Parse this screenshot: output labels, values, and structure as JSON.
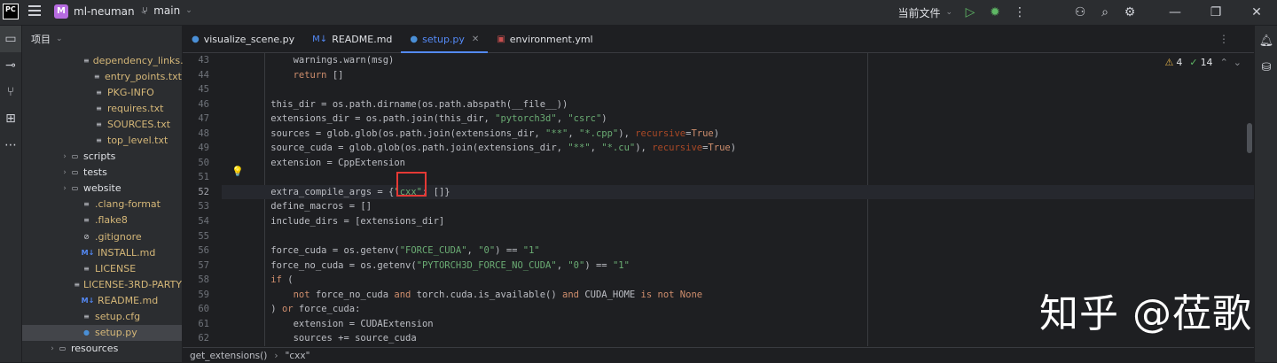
{
  "titlebar": {
    "logo": "PC",
    "project_initial": "M",
    "project_name": "ml-neuman",
    "branch": "main",
    "run_config": "当前文件"
  },
  "project_panel": {
    "title": "项目",
    "items": [
      {
        "label": "dependency_links.txt",
        "kind": "file",
        "color": "#d5b778"
      },
      {
        "label": "entry_points.txt",
        "kind": "file",
        "color": "#d5b778"
      },
      {
        "label": "PKG-INFO",
        "kind": "file",
        "color": "#d5b778"
      },
      {
        "label": "requires.txt",
        "kind": "file",
        "color": "#d5b778"
      },
      {
        "label": "SOURCES.txt",
        "kind": "file",
        "color": "#d5b778"
      },
      {
        "label": "top_level.txt",
        "kind": "file",
        "color": "#d5b778"
      },
      {
        "label": "scripts",
        "kind": "folder",
        "color": "#dfe1e5"
      },
      {
        "label": "tests",
        "kind": "folder",
        "color": "#dfe1e5"
      },
      {
        "label": "website",
        "kind": "folder",
        "color": "#dfe1e5"
      },
      {
        "label": ".clang-format",
        "kind": "file",
        "color": "#d5b778"
      },
      {
        "label": ".flake8",
        "kind": "file",
        "color": "#d5b778"
      },
      {
        "label": ".gitignore",
        "kind": "ignore",
        "color": "#d5b778"
      },
      {
        "label": "INSTALL.md",
        "kind": "md",
        "color": "#d5b778"
      },
      {
        "label": "LICENSE",
        "kind": "file",
        "color": "#d5b778"
      },
      {
        "label": "LICENSE-3RD-PARTY",
        "kind": "file",
        "color": "#d5b778"
      },
      {
        "label": "README.md",
        "kind": "md",
        "color": "#d5b778"
      },
      {
        "label": "setup.cfg",
        "kind": "file",
        "color": "#d5b778"
      },
      {
        "label": "setup.py",
        "kind": "py",
        "color": "#d5b778",
        "selected": true
      },
      {
        "label": "resources",
        "kind": "folder",
        "color": "#dfe1e5"
      }
    ]
  },
  "tabs": [
    {
      "label": "visualize_scene.py",
      "icon": "python-icon",
      "active": false
    },
    {
      "label": "README.md",
      "icon": "markdown-icon",
      "active": false
    },
    {
      "label": "setup.py",
      "icon": "python-icon",
      "active": true
    },
    {
      "label": "environment.yml",
      "icon": "yaml-icon",
      "active": false
    }
  ],
  "inspections": {
    "warnings": "4",
    "ok": "14"
  },
  "code": {
    "lines": [
      {
        "n": "43",
        "html": "        warnings.warn(msg)"
      },
      {
        "n": "44",
        "html": "        <span class='kw'>return</span> []"
      },
      {
        "n": "45",
        "html": ""
      },
      {
        "n": "46",
        "html": "    this_dir = os.path.dirname(os.path.abspath(__file__))"
      },
      {
        "n": "47",
        "html": "    extensions_dir = os.path.join(this_dir, <span class='str'>\"pytorch3d\"</span>, <span class='str'>\"csrc\"</span>)"
      },
      {
        "n": "48",
        "html": "    sources = glob.glob(os.path.join(extensions_dir, <span class='str'>\"**\"</span>, <span class='str'>\"*.cpp\"</span>), <span class='kwa'>recursive</span>=<span class='kw'>True</span>)"
      },
      {
        "n": "49",
        "html": "    source_cuda = glob.glob(os.path.join(extensions_dir, <span class='str'>\"**\"</span>, <span class='str'>\"*.cu\"</span>), <span class='kwa'>recursive</span>=<span class='kw'>True</span>)"
      },
      {
        "n": "50",
        "html": "    extension = CppExtension"
      },
      {
        "n": "51",
        "html": ""
      },
      {
        "n": "52",
        "html": "    extra_compile_args = {<span class='str'>\"cxx\"</span>: []}",
        "current": true
      },
      {
        "n": "53",
        "html": "    define_macros = []"
      },
      {
        "n": "54",
        "html": "    include_dirs = [extensions_dir]"
      },
      {
        "n": "55",
        "html": ""
      },
      {
        "n": "56",
        "html": "    force_cuda = os.getenv(<span class='str'>\"FORCE_CUDA\"</span>, <span class='str'>\"0\"</span>) == <span class='str'>\"1\"</span>"
      },
      {
        "n": "57",
        "html": "    force_no_cuda = os.getenv(<span class='str'>\"PYTORCH3D_FORCE_NO_CUDA\"</span>, <span class='str'>\"0\"</span>) == <span class='str'>\"1\"</span>"
      },
      {
        "n": "58",
        "html": "    <span class='kw'>if</span> ("
      },
      {
        "n": "59",
        "html": "        <span class='kw'>not</span> force_no_cuda <span class='kw'>and</span> torch.cuda.is_available() <span class='kw'>and</span> CUDA_HOME <span class='kw'>is not None</span>"
      },
      {
        "n": "60",
        "html": "    ) <span class='kw'>or</span> force_cuda:"
      },
      {
        "n": "61",
        "html": "        extension = CUDAExtension"
      },
      {
        "n": "62",
        "html": "        sources += source_cuda"
      }
    ]
  },
  "statusbar": {
    "crumb1": "get_extensions()",
    "crumb2": "\"cxx\""
  },
  "watermark": "知乎 @莅歌"
}
